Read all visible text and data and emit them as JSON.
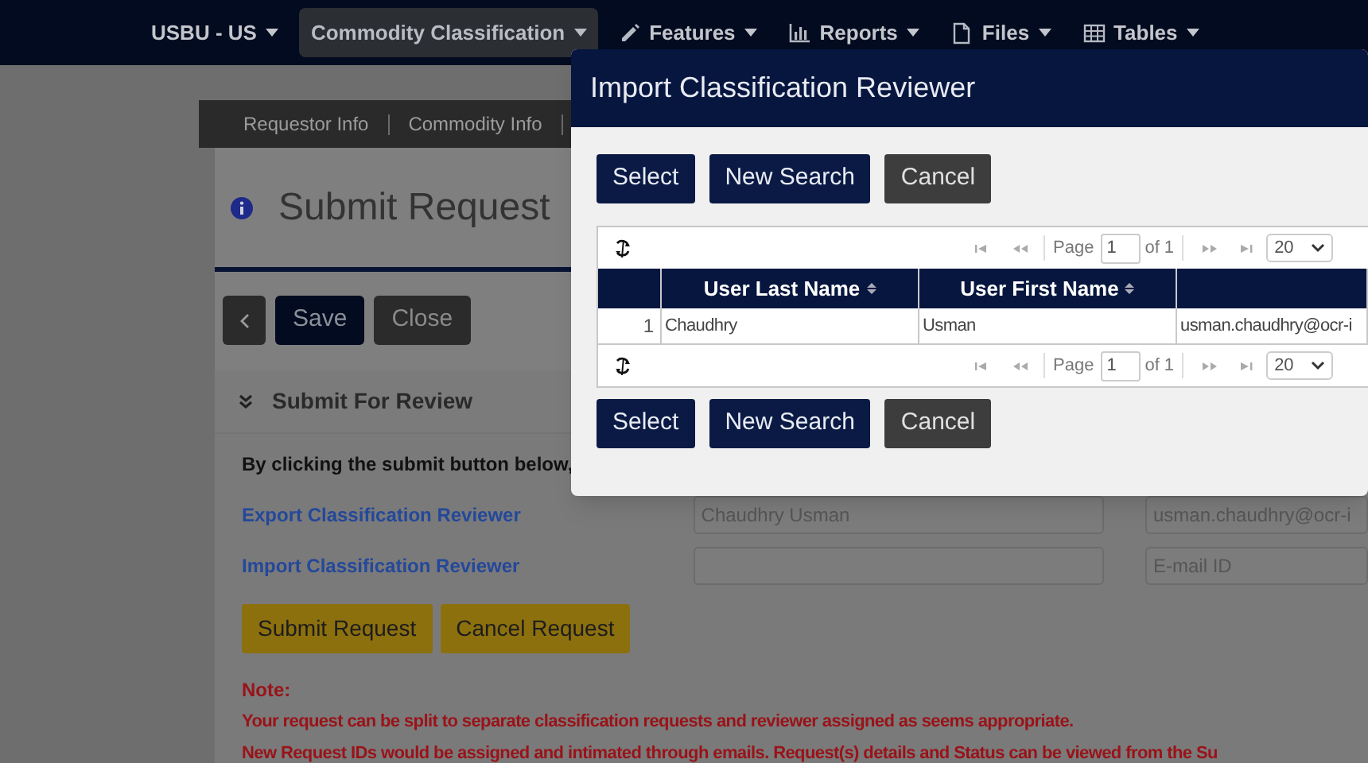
{
  "nav": {
    "items": [
      {
        "label": "USBU - US",
        "selected": false
      },
      {
        "label": "Commodity Classification",
        "selected": true
      },
      {
        "label": "Features",
        "selected": false
      },
      {
        "label": "Reports",
        "selected": false
      },
      {
        "label": "Files",
        "selected": false
      },
      {
        "label": "Tables",
        "selected": false
      }
    ]
  },
  "subnav": {
    "tabs": [
      "Requestor Info",
      "Commodity Info"
    ]
  },
  "page": {
    "title": "Submit Request",
    "toolbar": [
      "Save",
      "Close"
    ],
    "section": {
      "title": "Submit For Review",
      "expanded": true,
      "intro": "By clicking the submit button below,",
      "reviewers": [
        {
          "label": "Export Classification Reviewer",
          "name_value": "Chaudhry Usman",
          "email_value": "usman.chaudhry@ocr-i"
        },
        {
          "label": "Import Classification Reviewer",
          "email_placeholder": "E-mail ID"
        }
      ],
      "buttons": [
        "Submit Request",
        "Cancel Request"
      ],
      "note_title": "Note:",
      "notes": [
        "Your request can be split to separate classification requests and reviewer assigned as seems appropriate.",
        "New Request IDs would be assigned and intimated through emails. Request(s) details and Status can be viewed from the Su"
      ]
    }
  },
  "modal": {
    "title": "Import Classification Reviewer",
    "buttons_top": [
      "Select",
      "New Search",
      "Cancel"
    ],
    "pager": {
      "page_label": "Page",
      "page": "1",
      "of": "of 1",
      "page_size": "20"
    },
    "columns": [
      {
        "sortable": false
      },
      {
        "label": "User Last Name",
        "sortable": true
      },
      {
        "label": "User First Name",
        "sortable": true
      },
      {
        "sortable": false
      }
    ],
    "rows": [
      {
        "index": "1",
        "cells": [
          "Chaudhry",
          "Usman",
          "usman.chaudhry@ocr-i"
        ],
        "selected": false
      }
    ],
    "pager_bottom": {
      "page_label": "Page",
      "page": "1",
      "of": "of 1",
      "page_size": "20"
    },
    "buttons_bottom": [
      "Select",
      "New Search",
      "Cancel"
    ]
  }
}
